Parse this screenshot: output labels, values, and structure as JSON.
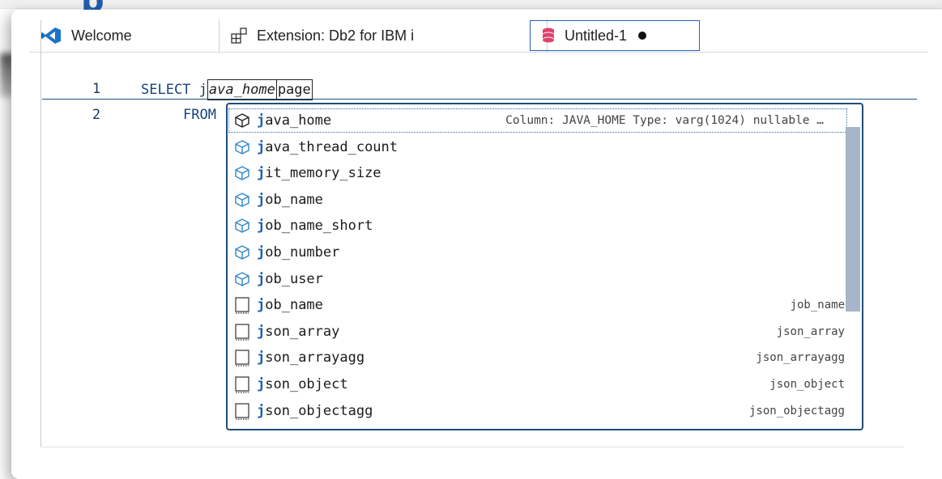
{
  "tabs": [
    {
      "label": "Welcome",
      "icon": "vscode-icon"
    },
    {
      "label": "Extension: Db2 for IBM i",
      "icon": "extension-preview-icon"
    },
    {
      "label": "Untitled-1",
      "icon": "database-icon",
      "dirty": true
    }
  ],
  "editor": {
    "lines": [
      {
        "number": "1",
        "keyword": "SELECT",
        "typed": "j",
        "ghost": "ava_home",
        "trailing": "page"
      },
      {
        "number": "2",
        "keyword": "FROM"
      }
    ]
  },
  "suggestions": [
    {
      "prefix": "j",
      "rest": "ava_home",
      "kind": "column",
      "detail": "Column: JAVA_HOME Type: varg(1024) nullable …",
      "selected": true
    },
    {
      "prefix": "j",
      "rest": "ava_thread_count",
      "kind": "column",
      "detail": ""
    },
    {
      "prefix": "j",
      "rest": "it_memory_size",
      "kind": "column",
      "detail": ""
    },
    {
      "prefix": "j",
      "rest": "ob_name",
      "kind": "column",
      "detail": ""
    },
    {
      "prefix": "j",
      "rest": "ob_name_short",
      "kind": "column",
      "detail": ""
    },
    {
      "prefix": "j",
      "rest": "ob_number",
      "kind": "column",
      "detail": ""
    },
    {
      "prefix": "j",
      "rest": "ob_user",
      "kind": "column",
      "detail": ""
    },
    {
      "prefix": "j",
      "rest": "ob_name",
      "kind": "snippet",
      "detail": "job_name"
    },
    {
      "prefix": "j",
      "rest": "son_array",
      "kind": "snippet",
      "detail": "json_array"
    },
    {
      "prefix": "j",
      "rest": "son_arrayagg",
      "kind": "snippet",
      "detail": "json_arrayagg"
    },
    {
      "prefix": "j",
      "rest": "son_object",
      "kind": "snippet",
      "detail": "json_object"
    },
    {
      "prefix": "j",
      "rest": "son_objectagg",
      "kind": "snippet",
      "detail": "json_objectagg"
    }
  ],
  "colors": {
    "accent": "#1f4e79",
    "match": "#1b5fae",
    "db_icon": "#e0426a"
  }
}
